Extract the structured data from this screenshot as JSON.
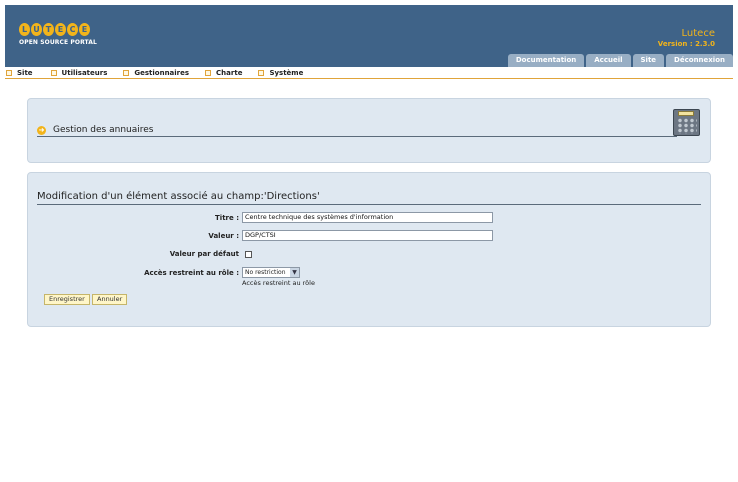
{
  "header": {
    "logo_letters": [
      "L",
      "U",
      "T",
      "E",
      "C",
      "E"
    ],
    "logo_subtitle": "OPEN SOURCE PORTAL",
    "brand_name": "Lutece",
    "version": "Version : 2.3.0",
    "tabs": [
      {
        "label": "Documentation"
      },
      {
        "label": "Accueil"
      },
      {
        "label": "Site"
      },
      {
        "label": "Déconnexion"
      }
    ]
  },
  "menu": {
    "items": [
      {
        "label": "Site"
      },
      {
        "label": "Utilisateurs"
      },
      {
        "label": "Gestionnaires"
      },
      {
        "label": "Charte"
      },
      {
        "label": "Système"
      }
    ]
  },
  "directory_panel": {
    "title": "Gestion des annuaires"
  },
  "form": {
    "title": "Modification d'un élément associé au champ:'Directions'",
    "title_label": "Titre :",
    "title_value": "Centre technique des systèmes d'information",
    "value_label": "Valeur :",
    "value_value": "DGP/CTSI",
    "default_label": "Valeur par défaut",
    "default_checked": false,
    "role_label": "Accès restreint au rôle :",
    "role_selected": "No restriction",
    "role_help": "Accès restreint au rôle",
    "save_label": "Enregistrer",
    "cancel_label": "Annuler"
  },
  "colors": {
    "header_bg": "#3f6388",
    "accent": "#f2b41b",
    "tab_bg": "#98aec4",
    "panel_bg": "#dfe8f1",
    "menu_border": "#e0a43a"
  }
}
